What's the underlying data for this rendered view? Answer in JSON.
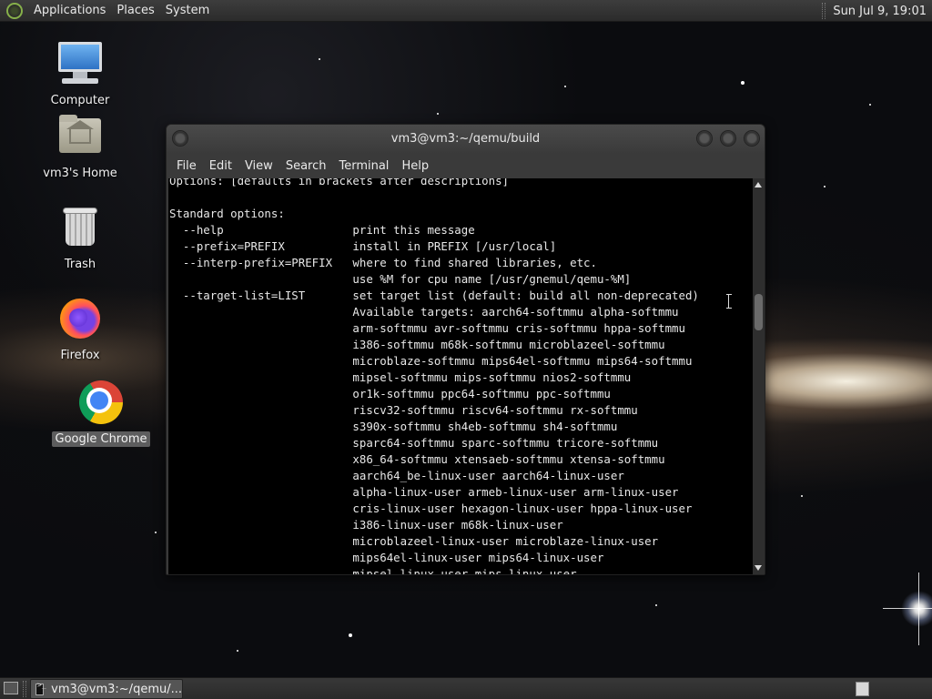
{
  "top_panel": {
    "menu": [
      "Applications",
      "Places",
      "System"
    ],
    "clock": "Sun Jul  9, 19:01"
  },
  "desktop": {
    "icons": [
      {
        "label": "Computer",
        "icon": "computer-icon"
      },
      {
        "label": "vm3's Home",
        "icon": "home-folder-icon"
      },
      {
        "label": "Trash",
        "icon": "trash-icon"
      },
      {
        "label": "Firefox",
        "icon": "firefox-icon"
      },
      {
        "label": "Google Chrome",
        "icon": "chrome-icon",
        "selected": true
      }
    ]
  },
  "terminal": {
    "title": "vm3@vm3:~/qemu/build",
    "menu": [
      "File",
      "Edit",
      "View",
      "Search",
      "Terminal",
      "Help"
    ],
    "lines": [
      "Options: [defaults in brackets after descriptions]",
      "",
      "Standard options:",
      "  --help                   print this message",
      "  --prefix=PREFIX          install in PREFIX [/usr/local]",
      "  --interp-prefix=PREFIX   where to find shared libraries, etc.",
      "                           use %M for cpu name [/usr/gnemul/qemu-%M]",
      "  --target-list=LIST       set target list (default: build all non-deprecated)",
      "                           Available targets: aarch64-softmmu alpha-softmmu",
      "                           arm-softmmu avr-softmmu cris-softmmu hppa-softmmu",
      "                           i386-softmmu m68k-softmmu microblazeel-softmmu",
      "                           microblaze-softmmu mips64el-softmmu mips64-softmmu",
      "                           mipsel-softmmu mips-softmmu nios2-softmmu",
      "                           or1k-softmmu ppc64-softmmu ppc-softmmu",
      "                           riscv32-softmmu riscv64-softmmu rx-softmmu",
      "                           s390x-softmmu sh4eb-softmmu sh4-softmmu",
      "                           sparc64-softmmu sparc-softmmu tricore-softmmu",
      "                           x86_64-softmmu xtensaeb-softmmu xtensa-softmmu",
      "                           aarch64_be-linux-user aarch64-linux-user",
      "                           alpha-linux-user armeb-linux-user arm-linux-user",
      "                           cris-linux-user hexagon-linux-user hppa-linux-user",
      "                           i386-linux-user m68k-linux-user",
      "                           microblazeel-linux-user microblaze-linux-user",
      "                           mips64el-linux-user mips64-linux-user",
      "                           mipsel-linux-user mips-linux-user"
    ]
  },
  "bottom_panel": {
    "task_label": "vm3@vm3:~/qemu/..."
  }
}
